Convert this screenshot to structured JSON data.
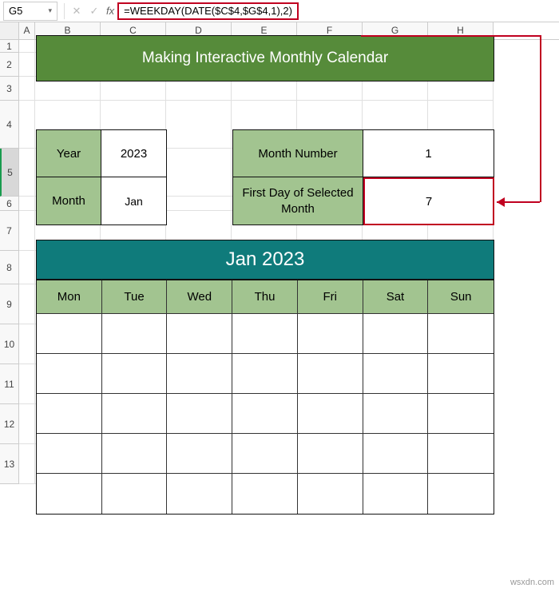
{
  "name_box": "G5",
  "formula": "=WEEKDAY(DATE($C$4,$G$4,1),2)",
  "columns": [
    "A",
    "B",
    "C",
    "D",
    "E",
    "F",
    "G",
    "H"
  ],
  "rows": [
    "1",
    "2",
    "3",
    "4",
    "5",
    "6",
    "7",
    "8",
    "9",
    "10",
    "11",
    "12",
    "13"
  ],
  "title": "Making Interactive Monthly Calendar",
  "labels": {
    "year": "Year",
    "month": "Month",
    "month_number": "Month Number",
    "first_day": "First Day of Selected Month"
  },
  "values": {
    "year": "2023",
    "month": "Jan",
    "month_number": "1",
    "first_day": "7"
  },
  "calendar": {
    "title": "Jan 2023",
    "days": [
      "Mon",
      "Tue",
      "Wed",
      "Thu",
      "Fri",
      "Sat",
      "Sun"
    ]
  },
  "watermark": "wsxdn.com"
}
